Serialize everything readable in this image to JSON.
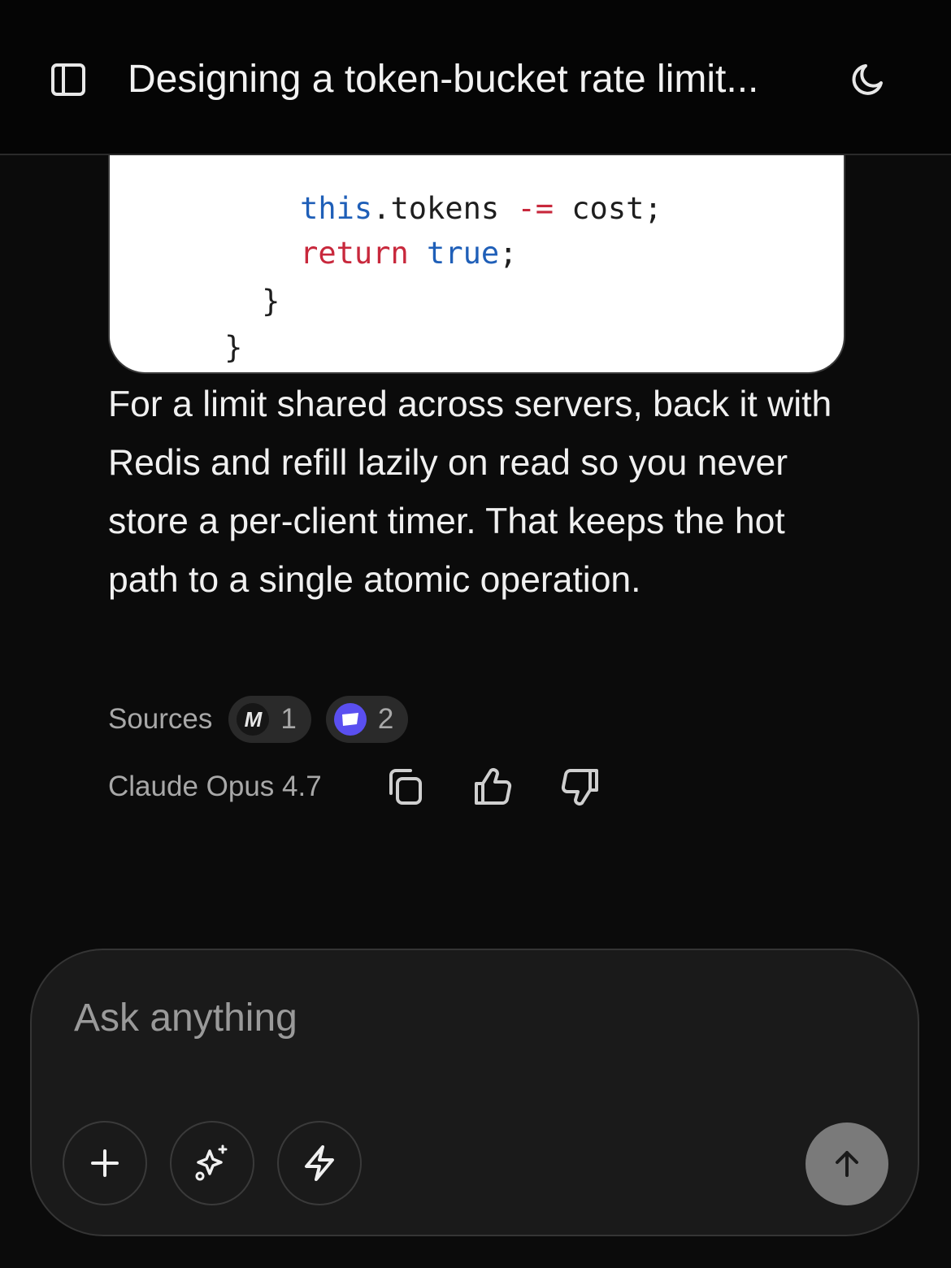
{
  "header": {
    "title": "Designing a token-bucket rate limit...",
    "sidebar_icon": "sidebar-toggle-icon",
    "theme_icon": "moon-icon"
  },
  "code": {
    "lines": [
      [
        {
          "t": "this",
          "c": "bl"
        },
        {
          "t": ".tokens "
        },
        {
          "t": "-=",
          "c": "op"
        },
        {
          "t": " cost;"
        }
      ],
      [
        {
          "t": "return",
          "c": "kw"
        },
        {
          "t": " "
        },
        {
          "t": "true",
          "c": "bl"
        },
        {
          "t": ";"
        }
      ],
      [
        {
          "t": "}"
        }
      ],
      [
        {
          "t": "}"
        }
      ]
    ]
  },
  "answer": {
    "text": "For a limit shared across servers, back it with Redis and refill lazily on read so you never store a per-client timer. That keeps the hot path to a single atomic operation."
  },
  "sources": {
    "label": "Sources",
    "chips": [
      {
        "icon_glyph": "M",
        "count": "1"
      },
      {
        "icon_glyph": "",
        "count": "2"
      }
    ]
  },
  "meta": {
    "model": "Claude Opus 4.7"
  },
  "composer": {
    "placeholder": "Ask anything"
  },
  "colors": {
    "background": "#0b0b0b",
    "code_keyword": "#c8283c",
    "code_literal": "#1f5fb8",
    "accent_source": "#5a4ff0",
    "send_button": "#7a7a7a"
  }
}
